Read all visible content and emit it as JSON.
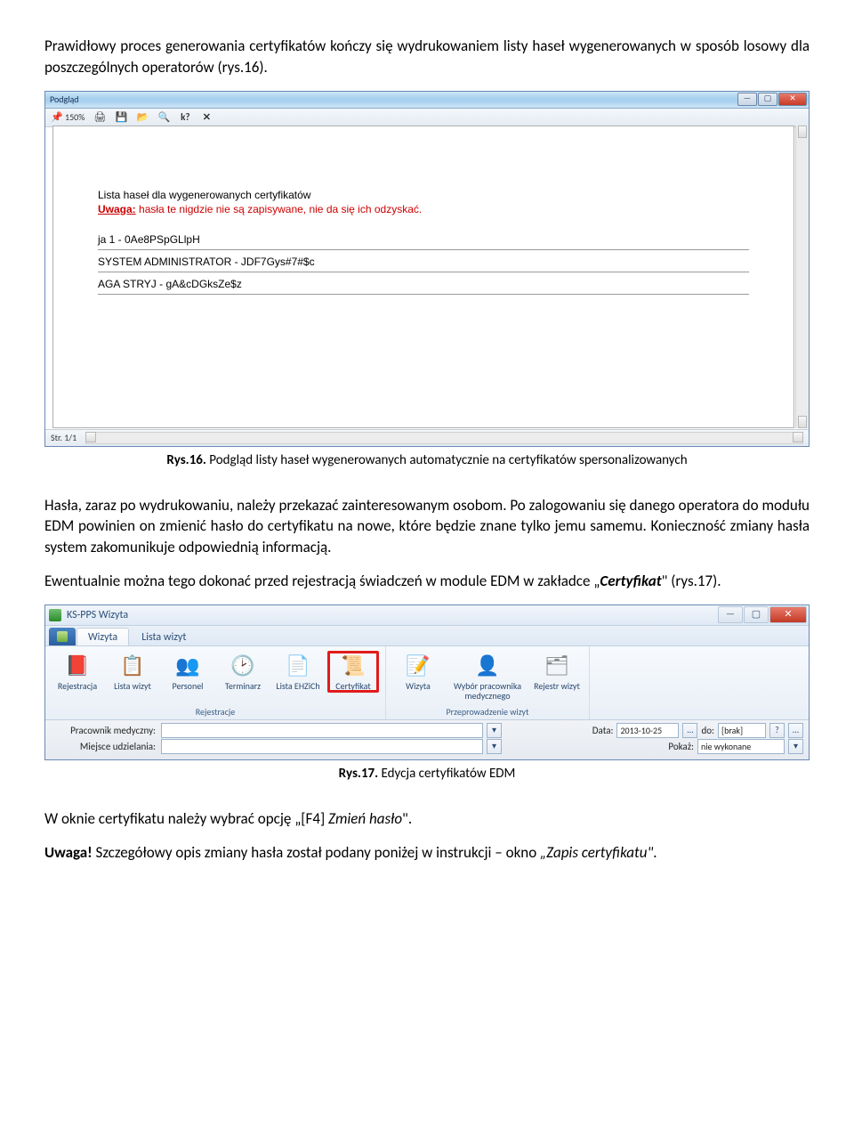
{
  "intro_para": "Prawidłowy proces generowania certyfikatów kończy się wydrukowaniem listy haseł wygenerowanych w sposób losowy dla poszczególnych operatorów (rys.16).",
  "fig1": {
    "caption_bold": "Rys.16.",
    "caption_rest": " Podgląd listy haseł wygenerowanych automatycznie na certyfikatów spersonalizowanych",
    "window_title": "Podgląd",
    "zoom": "150%",
    "status": "Str. 1/1",
    "heading": "Lista haseł dla wygenerowanych certyfikatów",
    "warning_label": "Uwaga:",
    "warning_text": " hasła te nigdzie nie są zapisywane, nie da się ich odzyskać.",
    "rows": [
      "ja 1 - 0Ae8PSpGLlpH",
      "SYSTEM ADMINISTRATOR - JDF7Gys#7#$c",
      "AGA STRYJ - gA&cDGksZe$z"
    ]
  },
  "mid_para1": "Hasła, zaraz po wydrukowaniu, należy przekazać zainteresowanym osobom. Po zalogowaniu się danego operatora do modułu EDM powinien on zmienić hasło do certyfikatu na nowe, które będzie znane tylko jemu samemu. Konieczność zmiany hasła system zakomunikuje odpowiednią informacją.",
  "mid_para2_a": "Ewentualnie można tego dokonać przed rejestracją świadczeń w module EDM w zakładce „",
  "mid_para2_b": "Certyfikat",
  "mid_para2_c": "\" (rys.17).",
  "fig2": {
    "caption_bold": "Rys.17.",
    "caption_rest": " Edycja certyfikatów EDM",
    "app_title": "KS-PPS Wizyta",
    "tabs": [
      "Wizyta",
      "Lista wizyt"
    ],
    "group1_label": "Rejestracje",
    "group2_label": "Przeprowadzenie wizyt",
    "buttons": {
      "rejestracja": "Rejestracja",
      "lista_wizyt": "Lista wizyt",
      "personel": "Personel",
      "terminarz": "Terminarz",
      "lista_ehzich": "Lista EHZiCh",
      "certyfikat": "Certyfikat",
      "wizyta": "Wizyta",
      "wybor": "Wybór pracownika medycznego",
      "rejestr": "Rejestr wizyt"
    },
    "form": {
      "lbl1": "Pracownik medyczny:",
      "lbl2": "Miejsce udzielania:",
      "data_lbl": "Data:",
      "data_val": "2013-10-25",
      "do_lbl": "do:",
      "do_val": "[brak]",
      "pokaz_lbl": "Pokaż:",
      "pokaz_val": "nie wykonane"
    }
  },
  "end_para1_a": "W oknie certyfikatu należy wybrać opcję „[F4] ",
  "end_para1_b": "Zmień hasło",
  "end_para1_c": "\".",
  "end_para2_a": "Uwaga!",
  "end_para2_b": " Szczegółowy opis zmiany hasła został podany poniżej w instrukcji – okno ",
  "end_para2_c": "„Zapis certyfikatu\"",
  "end_para2_d": "."
}
